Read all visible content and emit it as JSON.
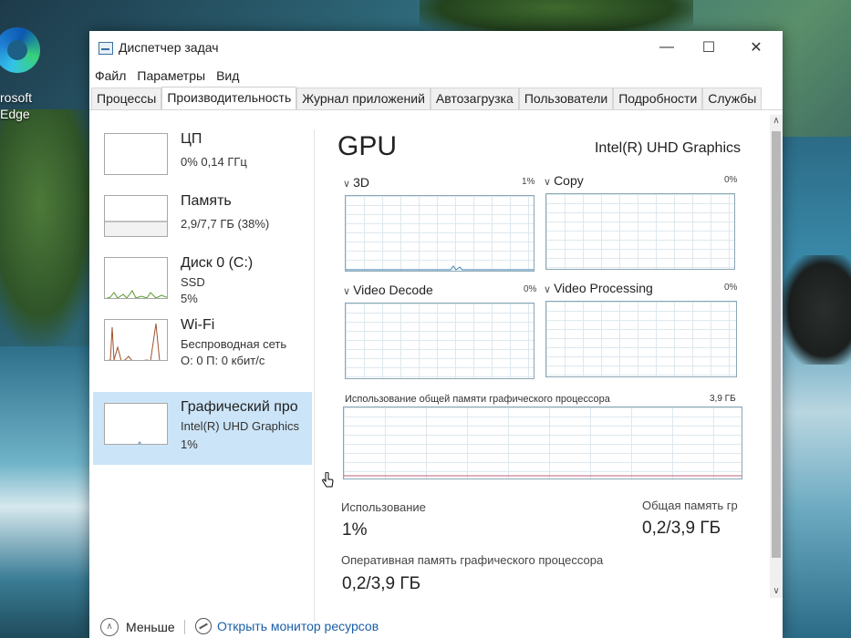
{
  "desktop": {
    "icon_label": "rosoft\nEdge",
    "icon_name": "edge-icon"
  },
  "window": {
    "title": "Диспетчер задач",
    "controls": {
      "minimize": "—",
      "maximize": "☐",
      "close": "✕"
    }
  },
  "menu": [
    "Файл",
    "Параметры",
    "Вид"
  ],
  "tabs": [
    "Процессы",
    "Производительность",
    "Журнал приложений",
    "Автозагрузка",
    "Пользователи",
    "Подробности",
    "Службы"
  ],
  "active_tab": "Производительность",
  "sidebar": [
    {
      "title": "ЦП",
      "sub1": "0% 0,14 ГГц",
      "sub2": ""
    },
    {
      "title": "Память",
      "sub1": "2,9/7,7 ГБ (38%)",
      "sub2": ""
    },
    {
      "title": "Диск 0 (C:)",
      "sub1": "SSD",
      "sub2": "5%"
    },
    {
      "title": "Wi-Fi",
      "sub1": "Беспроводная сеть",
      "sub2": "О: 0 П: 0 кбит/с"
    },
    {
      "title": "Графический про",
      "sub1": "Intel(R) UHD Graphics",
      "sub2": "1%"
    }
  ],
  "detail": {
    "heading": "GPU",
    "model": "Intel(R) UHD Graphics",
    "engines": [
      {
        "name": "3D",
        "pct": "1%"
      },
      {
        "name": "Copy",
        "pct": "0%"
      },
      {
        "name": "Video Decode",
        "pct": "0%"
      },
      {
        "name": "Video Processing",
        "pct": "0%"
      }
    ],
    "shared_memory_label": "Использование общей памяти графического процессора",
    "shared_memory_max": "3,9 ГБ",
    "stats": {
      "usage_label": "Использование",
      "usage_value": "1%",
      "shared_label": "Общая память гр",
      "shared_value": "0,2/3,9 ГБ",
      "dedicated_label": "Оперативная память графического процессора",
      "dedicated_value": "0,2/3,9 ГБ"
    }
  },
  "footer": {
    "less": "Меньше",
    "monitor": "Открыть монитор ресурсов"
  },
  "colors": {
    "selected_bg": "#cce4f7",
    "graph_border": "#8aa6b4",
    "link": "#1a5fa8",
    "memory_line": "#8b8b8b",
    "disk_line": "#5a9a2e",
    "wifi_line": "#a0522d"
  }
}
